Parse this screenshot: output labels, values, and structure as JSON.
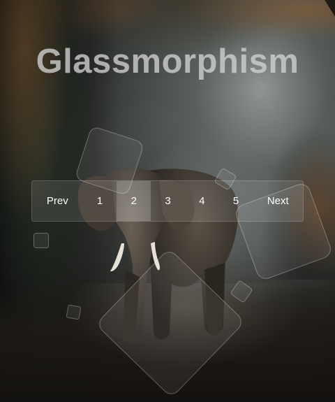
{
  "title": "Glassmorphism",
  "pagination": {
    "prev_label": "Prev",
    "pages": [
      "1",
      "2",
      "3",
      "4",
      "5"
    ],
    "active_page": "2",
    "next_label": "Next"
  },
  "colors": {
    "text": "#ffffff",
    "title": "#d2d2d2",
    "glass": "rgba(255,255,255,0.10)"
  },
  "background": {
    "subject": "elephant"
  }
}
